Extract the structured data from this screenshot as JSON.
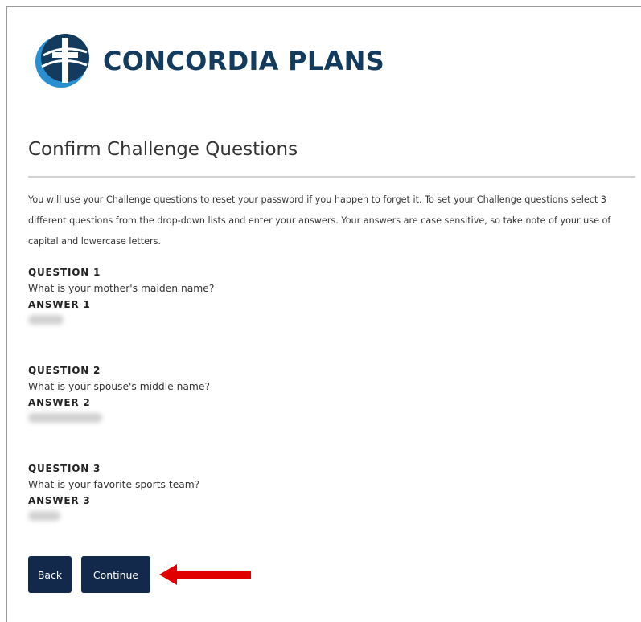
{
  "brand": {
    "name": "CONCORDIA PLANS"
  },
  "page": {
    "title": "Confirm Challenge Questions",
    "intro": "You will use your Challenge questions to reset your password if you happen to forget it. To set your Challenge questions select 3 different questions from the drop-down lists and enter your answers. Your answers are case sensitive, so take note of your use of capital and lowercase letters."
  },
  "questions": [
    {
      "label": "QUESTION 1",
      "text": "What is your mother's maiden name?",
      "answer_label": "ANSWER 1"
    },
    {
      "label": "QUESTION 2",
      "text": "What is your spouse's middle name?",
      "answer_label": "ANSWER 2"
    },
    {
      "label": "QUESTION 3",
      "text": "What is your favorite sports team?",
      "answer_label": "ANSWER 3"
    }
  ],
  "actions": {
    "back_label": "Back",
    "continue_label": "Continue"
  },
  "colors": {
    "brand_navy": "#123b5e",
    "button_navy": "#13294b",
    "logo_blue": "#2a8fd0",
    "annotation_red": "#e00000"
  },
  "icons": {
    "logo": "concordia-cross-globe-logo",
    "annotation": "red-arrow-left"
  }
}
